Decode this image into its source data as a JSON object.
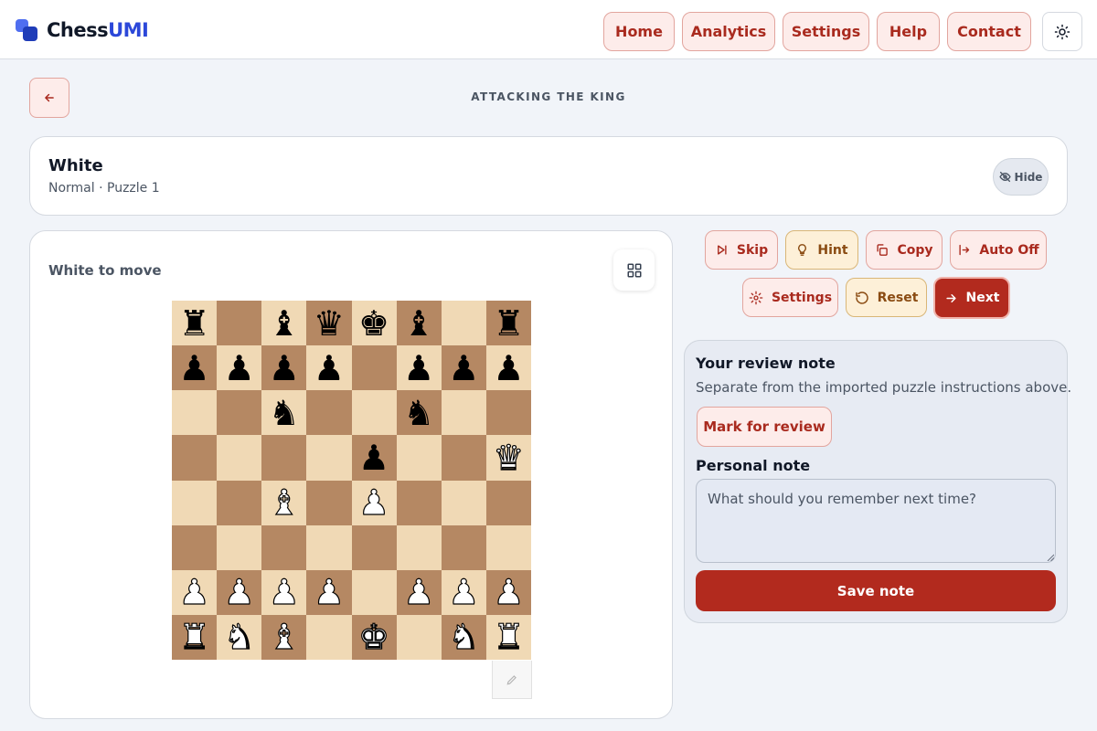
{
  "header": {
    "brand_main": "Chess",
    "brand_accent": "UMI",
    "nav": [
      "Home",
      "Analytics",
      "Settings",
      "Help",
      "Contact"
    ],
    "theme_icon": "sun-icon"
  },
  "page": {
    "back_icon": "arrow-left-icon",
    "title": "ATTACKING THE KING"
  },
  "puzzle_info": {
    "title": "White",
    "subtitle": "Normal · Puzzle 1",
    "hide_label": "Hide",
    "hide_icon": "eye-off-icon"
  },
  "board_panel": {
    "to_move": "White to move",
    "grid_icon": "grid-icon",
    "pen_icon": "pen-icon",
    "position": [
      [
        "r",
        "",
        "b",
        "q",
        "k",
        "b",
        "",
        "r"
      ],
      [
        "p",
        "p",
        "p",
        "p",
        "",
        "p",
        "p",
        "p"
      ],
      [
        "",
        "",
        "n",
        "",
        "",
        "n",
        "",
        ""
      ],
      [
        "",
        "",
        "",
        "",
        "p",
        "",
        "",
        "Q"
      ],
      [
        "",
        "",
        "B",
        "",
        "P",
        "",
        "",
        ""
      ],
      [
        "",
        "",
        "",
        "",
        "",
        "",
        "",
        ""
      ],
      [
        "P",
        "P",
        "P",
        "P",
        "",
        "P",
        "P",
        "P"
      ],
      [
        "R",
        "N",
        "B",
        "",
        "K",
        "",
        "N",
        "R"
      ]
    ],
    "colors": {
      "light_square": "#f0d9b5",
      "dark_square": "#b58863"
    }
  },
  "actions": {
    "skip": "Skip",
    "hint": "Hint",
    "copy": "Copy",
    "auto": "Auto Off",
    "settings": "Settings",
    "reset": "Reset",
    "next": "Next"
  },
  "review": {
    "title": "Your review note",
    "subtitle": "Separate from the imported puzzle instructions above.",
    "mark_label": "Mark for review",
    "note_label": "Personal note",
    "note_placeholder": "What should you remember next time?",
    "note_value": "",
    "save_label": "Save note"
  },
  "colors": {
    "accent": "#b22a1e",
    "accent_soft": "#fdecea",
    "brand_blue": "#2c48d9"
  }
}
